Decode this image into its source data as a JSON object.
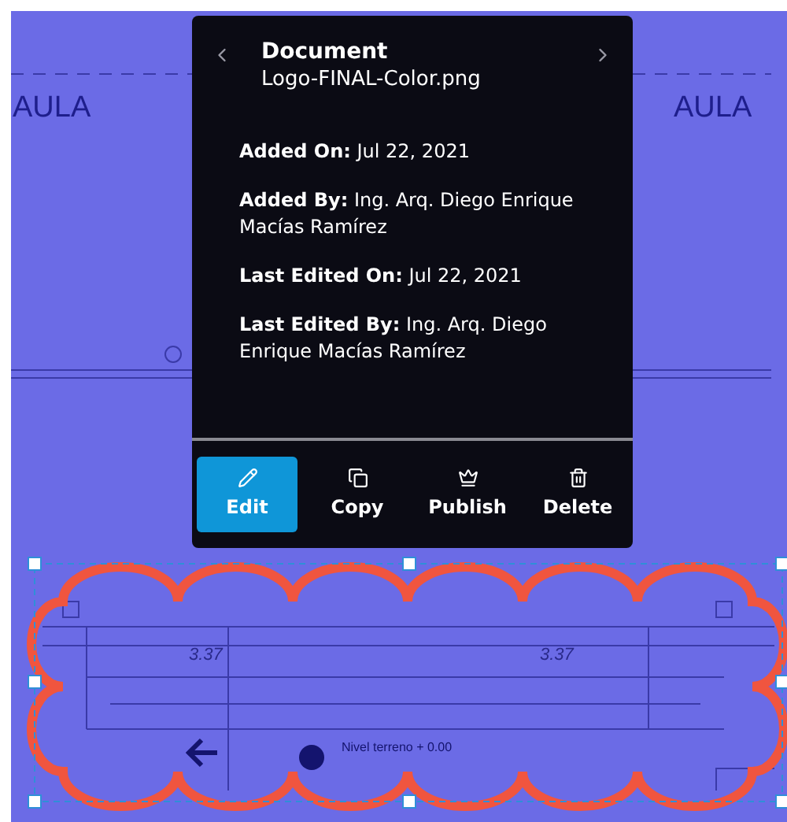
{
  "drawing": {
    "labels": [
      {
        "text": "AULA",
        "kind": "room"
      },
      {
        "text": "AULA",
        "kind": "room"
      },
      {
        "text": "3.37",
        "kind": "dimension"
      },
      {
        "text": "3.37",
        "kind": "dimension"
      },
      {
        "text": "Nivel terreno + 0.00",
        "kind": "note"
      }
    ]
  },
  "popup": {
    "title": "Document",
    "filename": "Logo-FINAL-Color.png",
    "fields": [
      {
        "text": "**Added On:** Jul 22, 2021"
      },
      {
        "text": "**Added By:** Ing. Arq. Diego Enrique Macías Ramírez"
      },
      {
        "text": "**Last Edited On:**  Jul 22, 2021"
      },
      {
        "text": "**Last Edited By:** Ing. Arq. Diego Enrique Macías Ramírez"
      }
    ],
    "actions": [
      {
        "kind": "edit",
        "label": "Edit",
        "selected": true
      },
      {
        "kind": "copy",
        "label": "Copy",
        "selected": false
      },
      {
        "kind": "publish",
        "label": "Publish",
        "selected": false
      },
      {
        "kind": "delete",
        "label": "Delete",
        "selected": false
      }
    ]
  }
}
